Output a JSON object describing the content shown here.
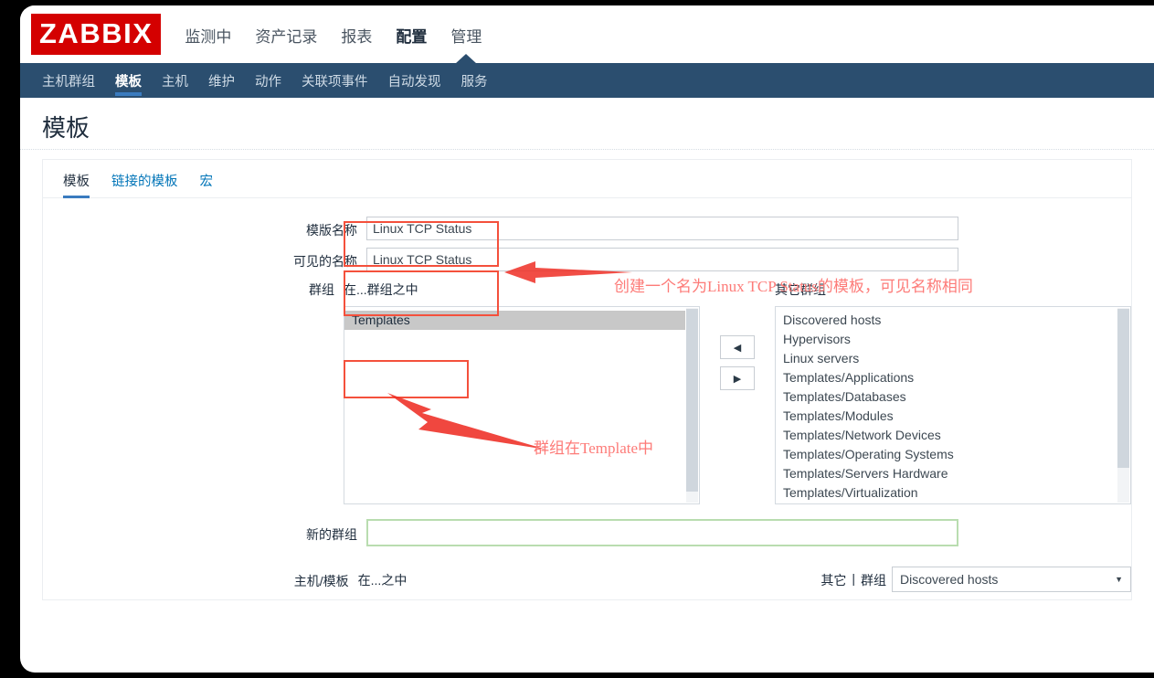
{
  "brand": {
    "logo_text": "ZABBIX",
    "logo_bg": "#d40000"
  },
  "topmenu": {
    "items": [
      {
        "label": "监测中",
        "active": false
      },
      {
        "label": "资产记录",
        "active": false
      },
      {
        "label": "报表",
        "active": false
      },
      {
        "label": "配置",
        "active": true
      },
      {
        "label": "管理",
        "active": false
      }
    ]
  },
  "subnav": {
    "bg": "#2b4e6f",
    "items": [
      {
        "label": "主机群组",
        "active": false
      },
      {
        "label": "模板",
        "active": true
      },
      {
        "label": "主机",
        "active": false
      },
      {
        "label": "维护",
        "active": false
      },
      {
        "label": "动作",
        "active": false
      },
      {
        "label": "关联项事件",
        "active": false
      },
      {
        "label": "自动发现",
        "active": false
      },
      {
        "label": "服务",
        "active": false
      }
    ]
  },
  "page": {
    "title": "模板"
  },
  "tabs": [
    {
      "label": "模板",
      "active": true
    },
    {
      "label": "链接的模板",
      "active": false
    },
    {
      "label": "宏",
      "active": false
    }
  ],
  "form": {
    "template_name": {
      "label": "模版名称",
      "value": "Linux TCP Status",
      "placeholder": ""
    },
    "visible_name": {
      "label": "可见的名称",
      "value": "Linux TCP Status",
      "placeholder": ""
    },
    "groups": {
      "label": "群组",
      "in_groups_caption": "在...群组之中",
      "other_groups_caption": "其它群组",
      "in_groups": [
        {
          "label": "Templates",
          "selected": true
        }
      ],
      "other_groups": [
        {
          "label": "Discovered hosts"
        },
        {
          "label": "Hypervisors"
        },
        {
          "label": "Linux servers"
        },
        {
          "label": "Templates/Applications"
        },
        {
          "label": "Templates/Databases"
        },
        {
          "label": "Templates/Modules"
        },
        {
          "label": "Templates/Network Devices"
        },
        {
          "label": "Templates/Operating Systems"
        },
        {
          "label": "Templates/Servers Hardware"
        },
        {
          "label": "Templates/Virtualization"
        }
      ],
      "move_left_icon": "triangle-left-icon",
      "move_right_icon": "triangle-right-icon"
    },
    "new_group": {
      "label": "新的群组",
      "value": "",
      "placeholder": ""
    },
    "hosts_templates": {
      "label": "主机/模板",
      "in_caption": "在...之中",
      "other_label": "其它",
      "separator": "|",
      "group_label": "群组",
      "dropdown_value": "Discovered hosts",
      "dropdown_caret": "▼"
    }
  },
  "annotations": {
    "accent_color": "#fd7b78",
    "box_color": "#f4503c",
    "name_note": "创建一个名为Linux TCP Status的模板，可见名称相同",
    "group_note": "群组在Template中"
  }
}
